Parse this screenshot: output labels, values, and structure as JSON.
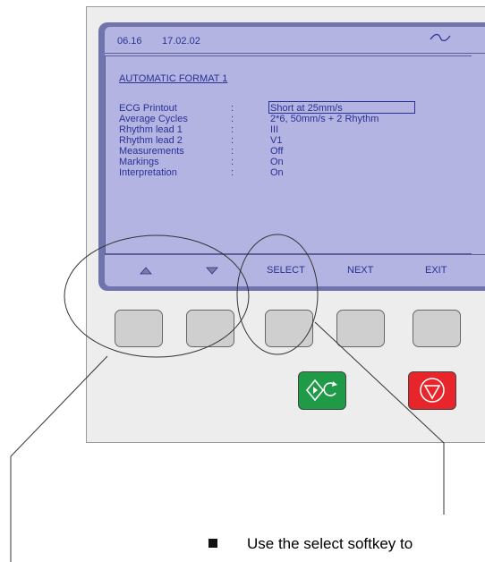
{
  "screen": {
    "time": "06.16",
    "date": "17.02.02",
    "title": "AUTOMATIC FORMAT 1",
    "rows": [
      {
        "label": "ECG Printout",
        "sep": ":",
        "value": "Short at 25mm/s"
      },
      {
        "label": "Average Cycles",
        "sep": ":",
        "value": "2*6, 50mm/s + 2 Rhythm"
      },
      {
        "label": "Rhythm lead 1",
        "sep": ":",
        "value": "III"
      },
      {
        "label": "Rhythm lead 2",
        "sep": ":",
        "value": "V1"
      },
      {
        "label": "Measurements",
        "sep": ":",
        "value": "Off"
      },
      {
        "label": "Markings",
        "sep": ":",
        "value": "On"
      },
      {
        "label": "Interpretation",
        "sep": ":",
        "value": "On"
      }
    ]
  },
  "softkeys": {
    "select": "SELECT",
    "next": "NEXT",
    "exit": "EXIT"
  },
  "icons": {
    "signal": "sine-wave-icon",
    "up": "triangle-up-icon",
    "down": "triangle-down-icon",
    "start": "start-icon",
    "stop": "stop-icon"
  },
  "colors": {
    "screen_bg": "#b3b4e2",
    "screen_text": "#2a3094",
    "bezel": "#7173ad",
    "start_button": "#1f9a47",
    "stop_button": "#e8252a"
  },
  "caption": "Use the select softkey to"
}
